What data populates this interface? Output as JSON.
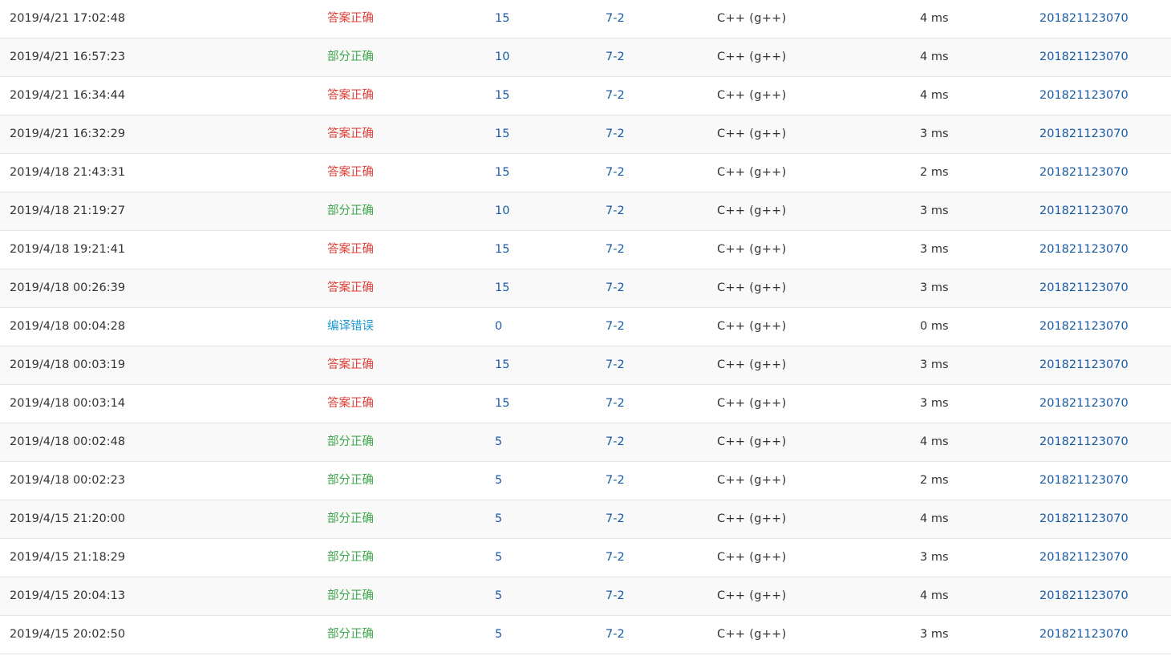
{
  "colors": {
    "accepted": "#e0413b",
    "partial": "#3fa84c",
    "compile_error": "#1f99d3",
    "link": "#1a5aa5"
  },
  "submissions": [
    {
      "time": "2019/4/21 17:02:48",
      "status": "答案正确",
      "status_type": "accepted",
      "score": "15",
      "problem": "7-2",
      "language": "C++ (g++)",
      "time_used": "4 ms",
      "user": "201821123070"
    },
    {
      "time": "2019/4/21 16:57:23",
      "status": "部分正确",
      "status_type": "partial",
      "score": "10",
      "problem": "7-2",
      "language": "C++ (g++)",
      "time_used": "4 ms",
      "user": "201821123070"
    },
    {
      "time": "2019/4/21 16:34:44",
      "status": "答案正确",
      "status_type": "accepted",
      "score": "15",
      "problem": "7-2",
      "language": "C++ (g++)",
      "time_used": "4 ms",
      "user": "201821123070"
    },
    {
      "time": "2019/4/21 16:32:29",
      "status": "答案正确",
      "status_type": "accepted",
      "score": "15",
      "problem": "7-2",
      "language": "C++ (g++)",
      "time_used": "3 ms",
      "user": "201821123070"
    },
    {
      "time": "2019/4/18 21:43:31",
      "status": "答案正确",
      "status_type": "accepted",
      "score": "15",
      "problem": "7-2",
      "language": "C++ (g++)",
      "time_used": "2 ms",
      "user": "201821123070"
    },
    {
      "time": "2019/4/18 21:19:27",
      "status": "部分正确",
      "status_type": "partial",
      "score": "10",
      "problem": "7-2",
      "language": "C++ (g++)",
      "time_used": "3 ms",
      "user": "201821123070"
    },
    {
      "time": "2019/4/18 19:21:41",
      "status": "答案正确",
      "status_type": "accepted",
      "score": "15",
      "problem": "7-2",
      "language": "C++ (g++)",
      "time_used": "3 ms",
      "user": "201821123070"
    },
    {
      "time": "2019/4/18 00:26:39",
      "status": "答案正确",
      "status_type": "accepted",
      "score": "15",
      "problem": "7-2",
      "language": "C++ (g++)",
      "time_used": "3 ms",
      "user": "201821123070"
    },
    {
      "time": "2019/4/18 00:04:28",
      "status": "编译错误",
      "status_type": "compile_error",
      "score": "0",
      "problem": "7-2",
      "language": "C++ (g++)",
      "time_used": "0 ms",
      "user": "201821123070"
    },
    {
      "time": "2019/4/18 00:03:19",
      "status": "答案正确",
      "status_type": "accepted",
      "score": "15",
      "problem": "7-2",
      "language": "C++ (g++)",
      "time_used": "3 ms",
      "user": "201821123070"
    },
    {
      "time": "2019/4/18 00:03:14",
      "status": "答案正确",
      "status_type": "accepted",
      "score": "15",
      "problem": "7-2",
      "language": "C++ (g++)",
      "time_used": "3 ms",
      "user": "201821123070"
    },
    {
      "time": "2019/4/18 00:02:48",
      "status": "部分正确",
      "status_type": "partial",
      "score": "5",
      "problem": "7-2",
      "language": "C++ (g++)",
      "time_used": "4 ms",
      "user": "201821123070"
    },
    {
      "time": "2019/4/18 00:02:23",
      "status": "部分正确",
      "status_type": "partial",
      "score": "5",
      "problem": "7-2",
      "language": "C++ (g++)",
      "time_used": "2 ms",
      "user": "201821123070"
    },
    {
      "time": "2019/4/15 21:20:00",
      "status": "部分正确",
      "status_type": "partial",
      "score": "5",
      "problem": "7-2",
      "language": "C++ (g++)",
      "time_used": "4 ms",
      "user": "201821123070"
    },
    {
      "time": "2019/4/15 21:18:29",
      "status": "部分正确",
      "status_type": "partial",
      "score": "5",
      "problem": "7-2",
      "language": "C++ (g++)",
      "time_used": "3 ms",
      "user": "201821123070"
    },
    {
      "time": "2019/4/15 20:04:13",
      "status": "部分正确",
      "status_type": "partial",
      "score": "5",
      "problem": "7-2",
      "language": "C++ (g++)",
      "time_used": "4 ms",
      "user": "201821123070"
    },
    {
      "time": "2019/4/15 20:02:50",
      "status": "部分正确",
      "status_type": "partial",
      "score": "5",
      "problem": "7-2",
      "language": "C++ (g++)",
      "time_used": "3 ms",
      "user": "201821123070"
    }
  ]
}
